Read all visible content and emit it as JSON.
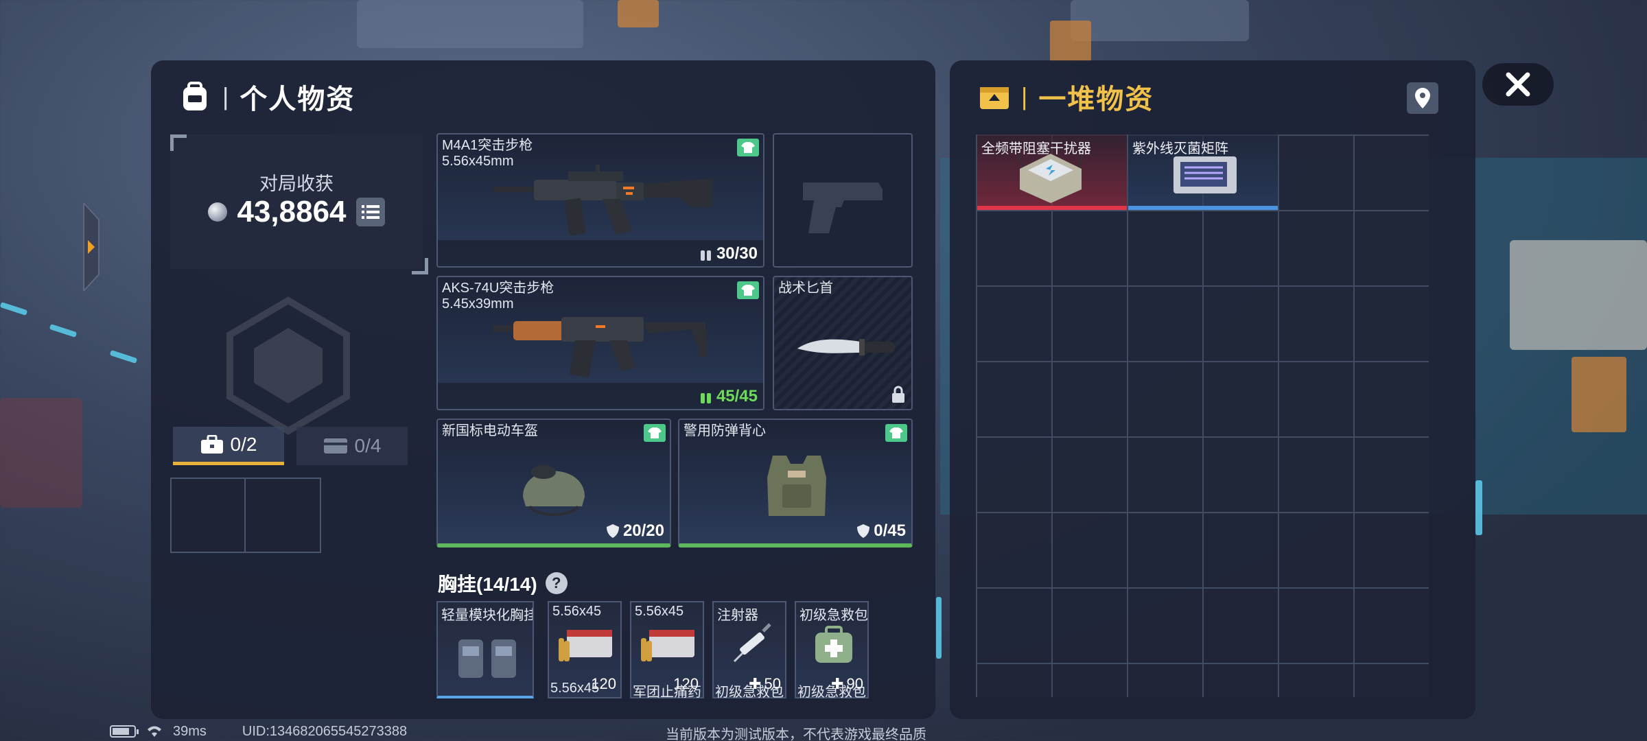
{
  "left_panel": {
    "title": "个人物资",
    "harvest": {
      "label": "对局收获",
      "value": "43,8864"
    },
    "tabs": [
      {
        "count": "0/2",
        "icon": "briefcase-icon"
      },
      {
        "count": "0/4",
        "icon": "card-icon"
      }
    ],
    "slots": {
      "rifle1": {
        "name": "M4A1突击步枪",
        "caliber": "5.56x45mm",
        "ammo": "30/30"
      },
      "rifle2": {
        "name": "AKS-74U突击步枪",
        "caliber": "5.45x39mm",
        "ammo": "45/45"
      },
      "knife": {
        "name": "战术匕首"
      },
      "helmet": {
        "name": "新国标电动车盔",
        "durability": "20/20"
      },
      "vest": {
        "name": "警用防弹背心",
        "durability": "0/45"
      }
    },
    "chest_rig": {
      "title": "胸挂(14/14)",
      "rig_name": "轻量模块化胸挂",
      "items": [
        {
          "name": "5.56x45",
          "qty": "120",
          "next": "5.56x45"
        },
        {
          "name": "5.56x45",
          "qty": "120",
          "next": "军团止痛药"
        },
        {
          "name": "注射器",
          "qty": "50",
          "next": "初级急救包"
        },
        {
          "name": "初级急救包",
          "qty": "90",
          "next": "初级急救包"
        }
      ]
    }
  },
  "right_panel": {
    "title": "一堆物资",
    "items": [
      {
        "name": "全频带阻塞干扰器",
        "rarity_color": "#e0364a"
      },
      {
        "name": "紫外线灭菌矩阵",
        "rarity_color": "#4a94e0"
      }
    ]
  },
  "status": {
    "ping": "39ms",
    "uid": "UID:134682065545273388",
    "disclaimer": "当前版本为测试版本，不代表游戏最终品质"
  },
  "colors": {
    "accent_yellow": "#e8b23a",
    "tag_green": "#4ec88a",
    "ammo_green": "#6ddc5a"
  }
}
